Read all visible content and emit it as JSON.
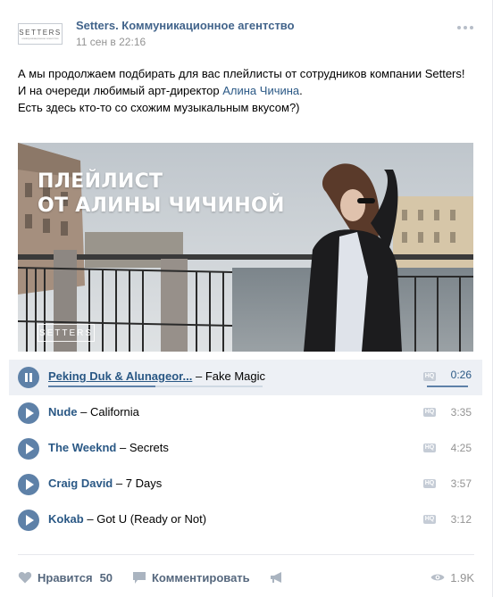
{
  "post": {
    "author": "Setters. Коммуникационное агентство",
    "date": "11 сен в 22:16",
    "avatar_logo": {
      "word": "SETTERS",
      "sub": "коммуникационное агентство"
    },
    "text": {
      "line1": "А мы продолжаем подбирать для вас плейлисты от сотрудников компании Setters!",
      "line2_prefix": "И на очереди любимый арт-директор ",
      "line2_link": "Алина Чичина",
      "line2_suffix": ".",
      "line3": "Есть здесь кто-то со схожим музыкальным вкусом?)"
    }
  },
  "photo": {
    "title_line1": "ПЛЕЙЛИСТ",
    "title_line2": "ОТ АЛИНЫ ЧИЧИНОЙ",
    "logo": "SETTERS"
  },
  "tracks": [
    {
      "artist": "Peking Duk & Alunageor...",
      "title": "Fake Magic",
      "duration": "0:26",
      "playing": true,
      "progress": 0.5
    },
    {
      "artist": "Nude",
      "title": "California",
      "duration": "3:35",
      "playing": false
    },
    {
      "artist": "The Weeknd",
      "title": "Secrets",
      "duration": "4:25",
      "playing": false
    },
    {
      "artist": "Craig David",
      "title": "7 Days",
      "duration": "3:57",
      "playing": false
    },
    {
      "artist": "Kokab",
      "title": "Got U (Ready or Not)",
      "duration": "3:12",
      "playing": false
    }
  ],
  "track_sep": "–",
  "hq_label": "HQ",
  "actions": {
    "like_label": "Нравится",
    "like_count": "50",
    "comment_label": "Комментировать",
    "views": "1.9K"
  },
  "icons": {
    "like": "heart-icon",
    "comment": "comment-icon",
    "share": "megaphone-icon",
    "views": "eye-icon",
    "more": "more-dots-icon"
  },
  "colors": {
    "link": "#2a5885",
    "author": "#42648b",
    "play": "#5e81a8",
    "active_row": "#edf0f5"
  }
}
